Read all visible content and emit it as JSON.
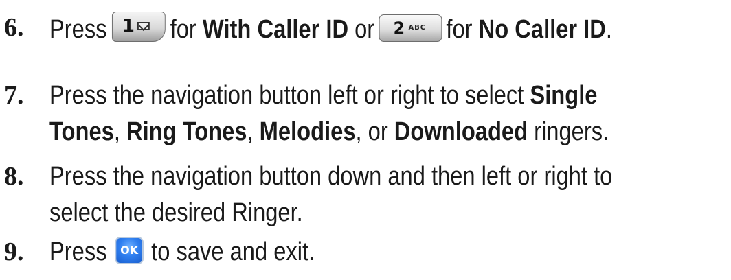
{
  "steps": [
    {
      "number": "6.",
      "press": "Press",
      "key1": {
        "digit": "1",
        "icon": "envelope-icon"
      },
      "for1": "for",
      "opt1": "With Caller ID",
      "or": "or",
      "key2": {
        "digit": "2",
        "letters": "ABC"
      },
      "for2": "for",
      "opt2": "No Caller ID",
      "end": "."
    },
    {
      "number": "7.",
      "text_a": "Press the navigation button left or right to select",
      "opt_single": "Single",
      "opt_tones": "Tones",
      "sep1": ",",
      "opt_ring": "Ring Tones",
      "sep2": ",",
      "opt_melodies": "Melodies",
      "sep3": ", or",
      "opt_downloaded": "Downloaded",
      "text_b": "ringers."
    },
    {
      "number": "8.",
      "line1": "Press the navigation button down and then left or right to",
      "line2": "select the desired Ringer."
    },
    {
      "number": "9.",
      "press": "Press",
      "key_ok": "OK",
      "rest": "to save and exit."
    }
  ],
  "colors": {
    "text": "#1a1a1a",
    "ok_key": "#2f7ff0"
  }
}
